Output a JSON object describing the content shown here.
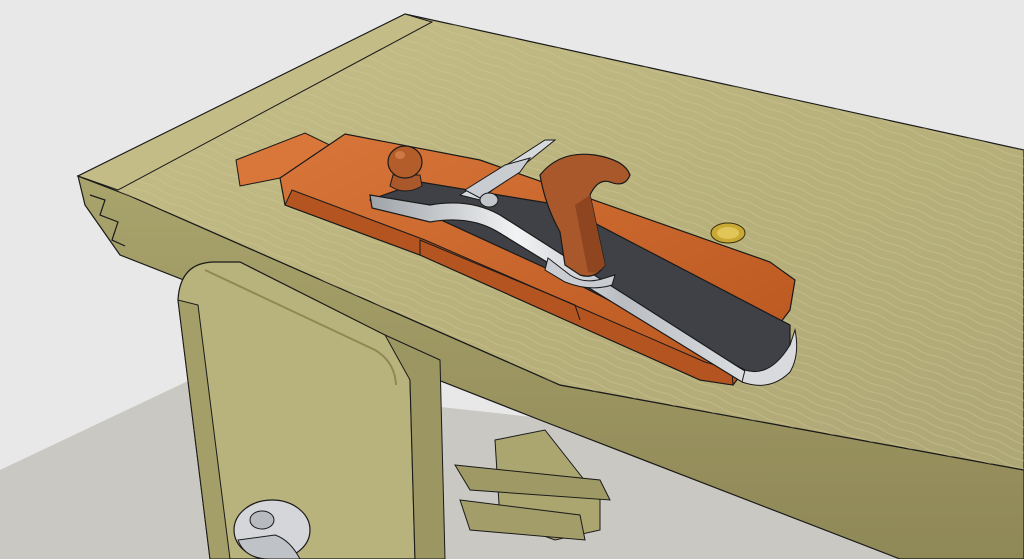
{
  "scene": {
    "subject": "woodworking-bench-with-plane",
    "colors": {
      "background": "#e8e8e8",
      "floor": "#c9c7c2",
      "bench_top": "#bcb57f",
      "bench_edge": "#a8a06a",
      "bench_dark": "#8f8856",
      "leg": "#b6b07a",
      "plane_wood": "#c8642a",
      "plane_wood_light": "#d97a3c",
      "plane_wood_dark": "#9e4a1c",
      "handle": "#a8582a",
      "sole": "#3e4044",
      "steel": "#c9ccd0",
      "brass": "#c9a934",
      "outline": "#1a1a1a"
    }
  }
}
